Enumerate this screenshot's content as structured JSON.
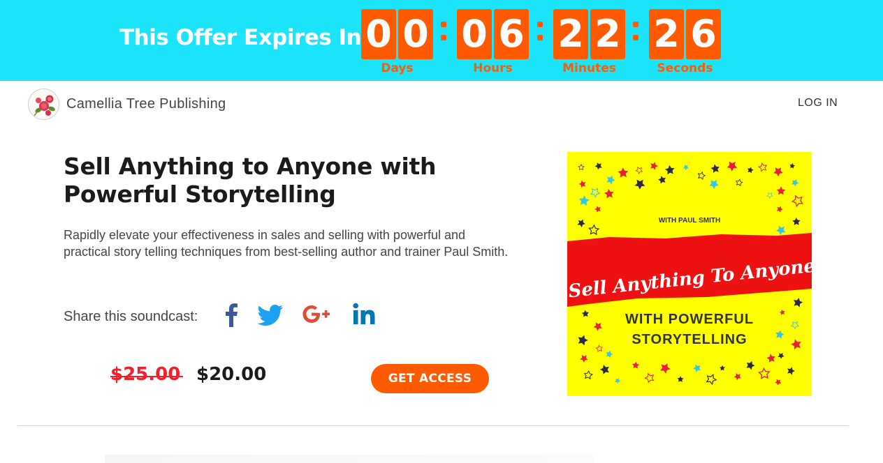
{
  "banner": {
    "title": "This Offer Expires In",
    "countdown": [
      {
        "d1": "0",
        "d2": "0",
        "label": "Days"
      },
      {
        "d1": "0",
        "d2": "6",
        "label": "Hours"
      },
      {
        "d1": "2",
        "d2": "2",
        "label": "Minutes"
      },
      {
        "d1": "2",
        "d2": "6",
        "label": "Seconds"
      }
    ],
    "colors": {
      "background": "#1ce4fb",
      "accent": "#ff5a00"
    }
  },
  "header": {
    "brand": "Camellia Tree Publishing",
    "login": "LOG IN",
    "logo_icon": "camellia-flower-icon"
  },
  "product": {
    "title": "Sell Anything to Anyone with Powerful Storytelling",
    "description": "Rapidly elevate your effectiveness in sales and selling with powerful and practical story telling techniques from best-selling author and trainer Paul Smith.",
    "share_label": "Share this soundcast:",
    "social": [
      "facebook-icon",
      "twitter-icon",
      "google-plus-icon",
      "linkedin-icon"
    ],
    "old_price": "$25.00",
    "new_price": "$20.00",
    "cta": "GET ACCESS"
  },
  "cover": {
    "byline": "WITH PAUL SMITH",
    "title": "Sell Anything To Anyone",
    "subtitle_line1": "WITH POWERFUL",
    "subtitle_line2": "STORYTELLING",
    "colors": {
      "background": "#ffff00",
      "stripe": "#ee1111"
    }
  }
}
